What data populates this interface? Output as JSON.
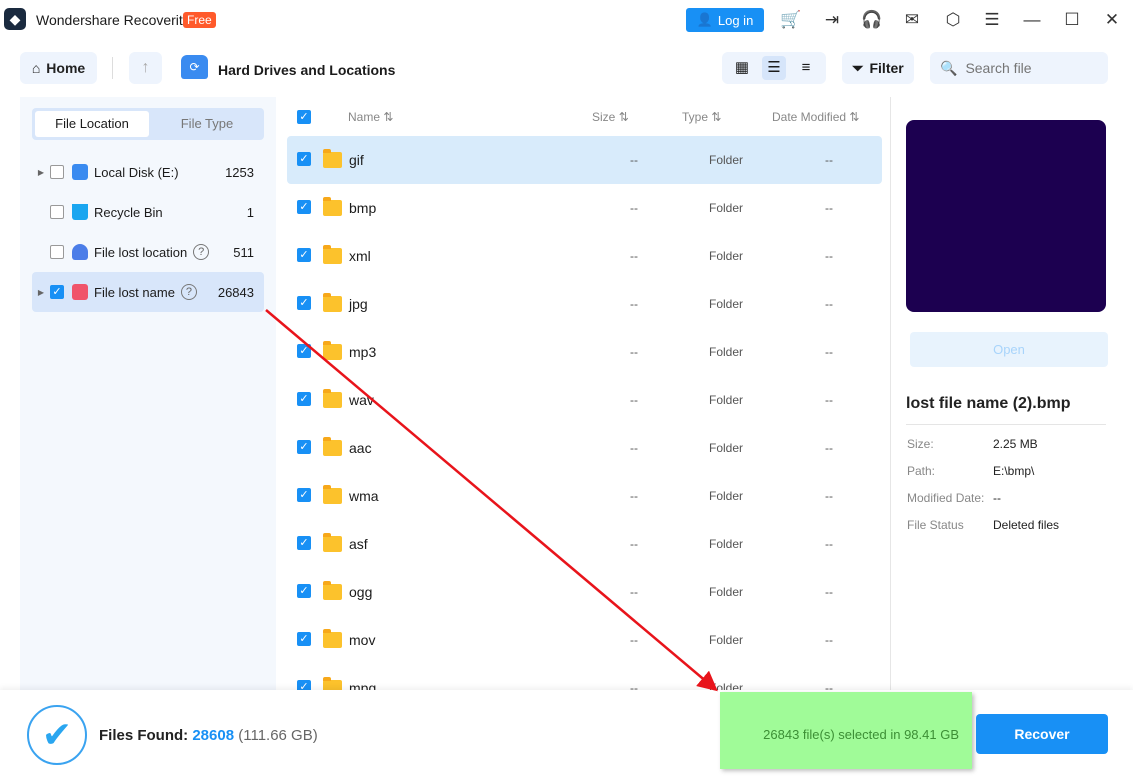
{
  "app": {
    "title": "Wondershare Recoverit",
    "badge": "Free",
    "login_label": "Log in",
    "accent": "#1890f5"
  },
  "toolbar": {
    "home_label": "Home",
    "breadcrumb": "Hard Drives and Locations",
    "filter_label": "Filter",
    "search_placeholder": "Search file"
  },
  "sidebar": {
    "tabs": [
      {
        "label": "File Location",
        "active": true
      },
      {
        "label": "File Type",
        "active": false
      }
    ],
    "items": [
      {
        "label": "Local Disk (E:)",
        "count": "1253",
        "checked": false,
        "expandable": true,
        "icon": "drive-icon"
      },
      {
        "label": "Recycle Bin",
        "count": "1",
        "checked": false,
        "expandable": false,
        "icon": "recycle-bin-icon"
      },
      {
        "label": "File lost location",
        "count": "511",
        "checked": false,
        "expandable": false,
        "icon": "lost-location-icon",
        "help": "?"
      },
      {
        "label": "File lost name",
        "count": "26843",
        "checked": true,
        "expandable": true,
        "icon": "lost-name-icon",
        "help": "?",
        "selected": true
      }
    ]
  },
  "table": {
    "headers": {
      "name": "Name",
      "size": "Size",
      "type": "Type",
      "date": "Date Modified",
      "sort_icon": "⇅"
    },
    "rows": [
      {
        "name": "gif",
        "size": "--",
        "type": "Folder",
        "date": "--"
      },
      {
        "name": "bmp",
        "size": "--",
        "type": "Folder",
        "date": "--"
      },
      {
        "name": "xml",
        "size": "--",
        "type": "Folder",
        "date": "--"
      },
      {
        "name": "jpg",
        "size": "--",
        "type": "Folder",
        "date": "--"
      },
      {
        "name": "mp3",
        "size": "--",
        "type": "Folder",
        "date": "--"
      },
      {
        "name": "wav",
        "size": "--",
        "type": "Folder",
        "date": "--"
      },
      {
        "name": "aac",
        "size": "--",
        "type": "Folder",
        "date": "--"
      },
      {
        "name": "wma",
        "size": "--",
        "type": "Folder",
        "date": "--"
      },
      {
        "name": "asf",
        "size": "--",
        "type": "Folder",
        "date": "--"
      },
      {
        "name": "ogg",
        "size": "--",
        "type": "Folder",
        "date": "--"
      },
      {
        "name": "mov",
        "size": "--",
        "type": "Folder",
        "date": "--"
      },
      {
        "name": "mpg",
        "size": "--",
        "type": "Folder",
        "date": "--"
      }
    ]
  },
  "preview": {
    "open_label": "Open",
    "file_name": "lost file name (2).bmp",
    "fields": [
      {
        "label": "Size:",
        "value": "2.25 MB"
      },
      {
        "label": "Path:",
        "value": "E:\\bmp\\"
      },
      {
        "label": "Modified Date:",
        "value": "--"
      },
      {
        "label": "File Status",
        "value": "Deleted files"
      }
    ]
  },
  "footer": {
    "found_label": "Files Found:",
    "found_count": "28608",
    "found_size": "(111.66 GB)",
    "selected_text": "26843 file(s) selected in 98.41 GB",
    "recover_label": "Recover"
  }
}
